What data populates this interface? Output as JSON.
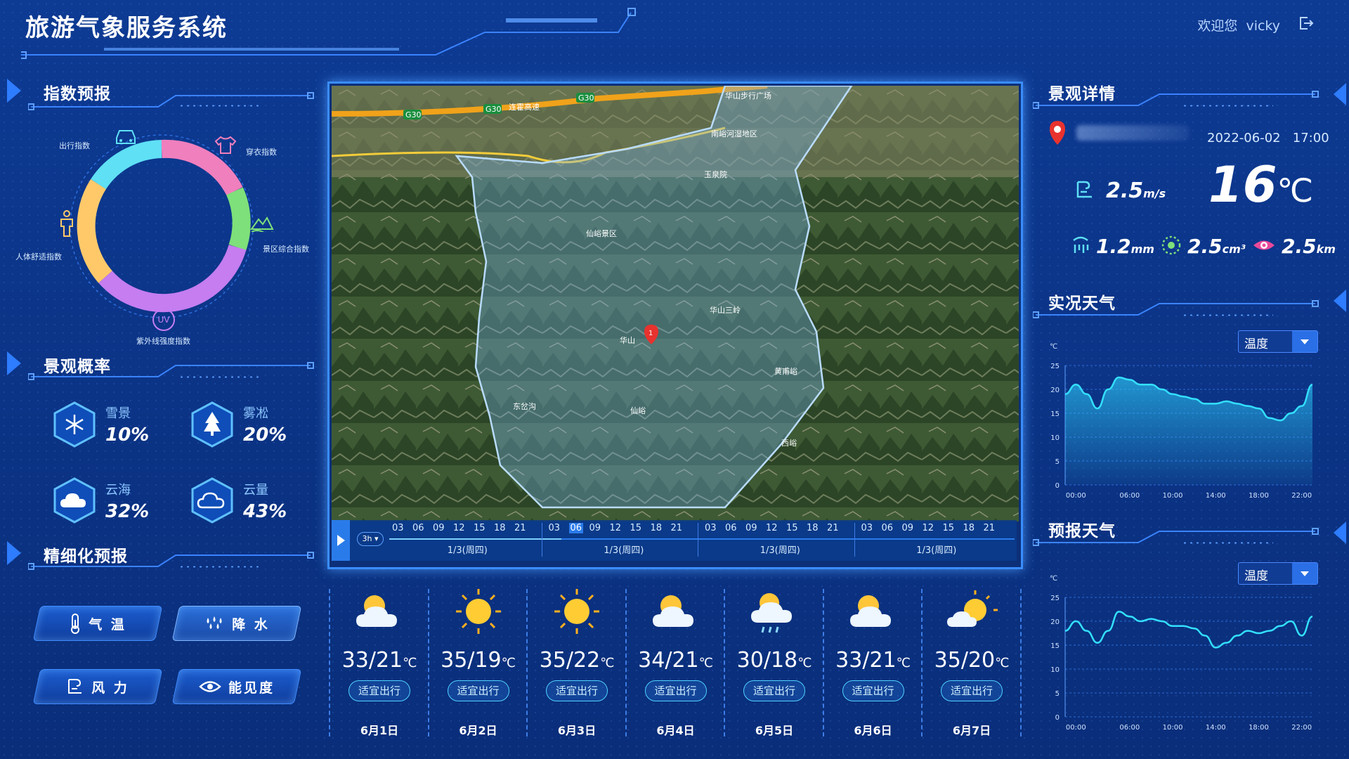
{
  "header": {
    "title": "旅游气象服务系统",
    "welcome": "欢迎您",
    "user": "vicky"
  },
  "index_forecast": {
    "title": "指数预报",
    "labels": {
      "travel": "出行指数",
      "clothing": "穿衣指数",
      "comfort": "人体舒适指数",
      "scenic": "景区综合指数",
      "uv": "紫外线强度指数"
    },
    "uv_icon": "UV"
  },
  "landscape_prob": {
    "title": "景观概率",
    "items": [
      {
        "name": "雪景",
        "value": "10%",
        "icon": "snowflake-icon"
      },
      {
        "name": "雾凇",
        "value": "20%",
        "icon": "tree-icon"
      },
      {
        "name": "云海",
        "value": "32%",
        "icon": "cloud-icon"
      },
      {
        "name": "云量",
        "value": "43%",
        "icon": "cloud-outline-icon"
      }
    ]
  },
  "fine_forecast": {
    "title": "精细化预报",
    "buttons": [
      {
        "label": "气 温"
      },
      {
        "label": "降 水"
      },
      {
        "label": "风 力"
      },
      {
        "label": "能见度"
      }
    ]
  },
  "map": {
    "marker": "1",
    "places": [
      "G30",
      "G30",
      "G30",
      "连霍高速",
      "华山步行广场",
      "南峪河湿地区",
      "仙峪景区",
      "华山",
      "西峪",
      "仙峪",
      "玉泉院",
      "华山三岭",
      "黄甫峪",
      "东岔沟"
    ],
    "timeline": {
      "interval": "3h",
      "hours": [
        "03",
        "06",
        "09",
        "12",
        "15",
        "18",
        "21"
      ],
      "days": [
        "1/3(周四)",
        "1/3(周四)",
        "1/3(周四)",
        "1/3(周四)"
      ],
      "selected_hour": "06"
    }
  },
  "daily": [
    {
      "temp": "33/21",
      "unit": "℃",
      "tag": "适宜出行",
      "date": "6月1日",
      "icon": "partly-cloudy-icon"
    },
    {
      "temp": "35/19",
      "unit": "℃",
      "tag": "适宜出行",
      "date": "6月2日",
      "icon": "sun-icon"
    },
    {
      "temp": "35/22",
      "unit": "℃",
      "tag": "适宜出行",
      "date": "6月3日",
      "icon": "sun-icon"
    },
    {
      "temp": "34/21",
      "unit": "℃",
      "tag": "适宜出行",
      "date": "6月4日",
      "icon": "partly-cloudy-icon"
    },
    {
      "temp": "30/18",
      "unit": "℃",
      "tag": "适宜出行",
      "date": "6月5日",
      "icon": "rain-icon"
    },
    {
      "temp": "33/21",
      "unit": "℃",
      "tag": "适宜出行",
      "date": "6月6日",
      "icon": "partly-cloudy-icon"
    },
    {
      "temp": "35/20",
      "unit": "℃",
      "tag": "适宜出行",
      "date": "6月7日",
      "icon": "sun-cloud-icon"
    }
  ],
  "landscape_detail": {
    "title": "景观详情",
    "datetime": "2022-06-02   17:00",
    "wind": {
      "value": "2.5",
      "unit": "m/s"
    },
    "temperature": {
      "value": "16",
      "unit": "℃"
    },
    "precip": {
      "value": "1.2",
      "unit": "mm"
    },
    "particles": {
      "value": "2.5",
      "unit": "cm³"
    },
    "visibility": {
      "value": "2.5",
      "unit": "km"
    }
  },
  "live_weather": {
    "title": "实况天气",
    "select": "温度",
    "unit": "℃"
  },
  "forecast_weather": {
    "title": "预报天气",
    "select": "温度",
    "unit": "℃"
  },
  "chart_data": [
    {
      "type": "area",
      "title": "实况天气",
      "ylabel": "℃",
      "ylim": [
        0,
        25
      ],
      "yticks": [
        0,
        5,
        10,
        15,
        20,
        25
      ],
      "xticks": [
        "00:00",
        "06:00",
        "10:00",
        "14:00",
        "18:00",
        "22:00"
      ],
      "x": [
        0,
        1,
        2,
        3,
        4,
        5,
        6,
        7,
        8,
        9,
        10,
        11,
        12,
        13,
        14,
        15,
        16,
        17,
        18,
        19,
        20,
        21,
        22,
        23
      ],
      "series": [
        {
          "values": [
            19,
            21,
            19,
            16,
            20,
            22.5,
            22,
            21,
            21,
            20,
            19,
            18.5,
            18,
            17,
            17,
            17.5,
            17,
            16.5,
            16,
            14,
            13.5,
            15,
            16.5,
            21
          ]
        }
      ]
    },
    {
      "type": "line",
      "title": "预报天气",
      "ylabel": "℃",
      "ylim": [
        0,
        25
      ],
      "yticks": [
        0,
        5,
        10,
        15,
        20,
        25
      ],
      "xticks": [
        "00:00",
        "06:00",
        "10:00",
        "14:00",
        "18:00",
        "22:00"
      ],
      "x": [
        0,
        1,
        2,
        3,
        4,
        5,
        6,
        7,
        8,
        9,
        10,
        11,
        12,
        13,
        14,
        15,
        16,
        17,
        18,
        19,
        20,
        21,
        22,
        23
      ],
      "series": [
        {
          "values": [
            18,
            20,
            18,
            15.5,
            18,
            22,
            21,
            20,
            20.5,
            20,
            19,
            19,
            18.5,
            17,
            14.5,
            15.5,
            17,
            18,
            17.5,
            18,
            19,
            20,
            17,
            21
          ]
        }
      ]
    }
  ]
}
